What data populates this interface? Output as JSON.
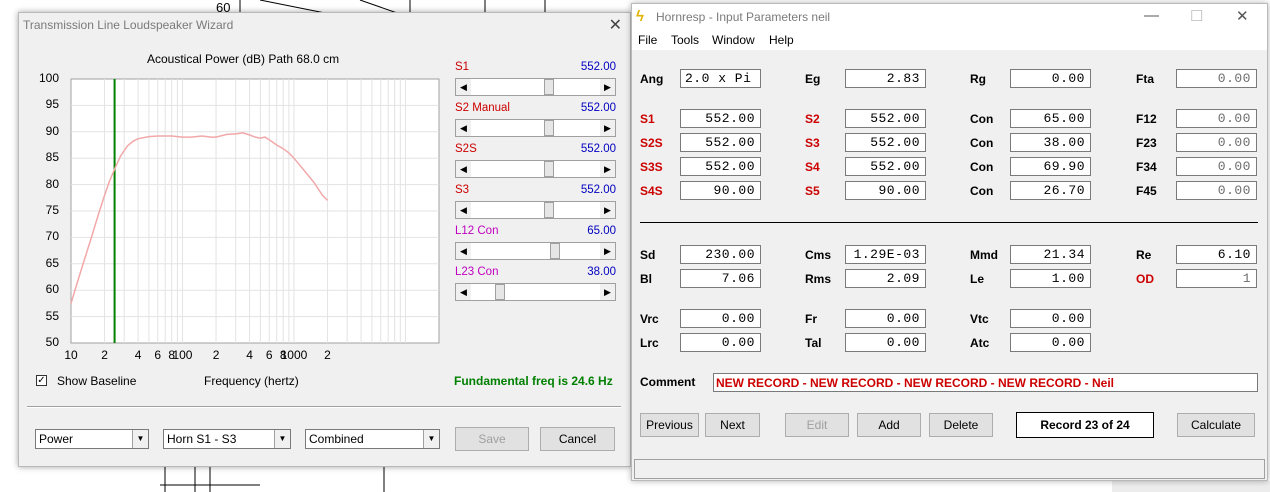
{
  "background": {
    "axis_label": "60"
  },
  "wizard": {
    "title": "Transmission Line Loudspeaker Wizard",
    "close_glyph": "✕",
    "chart_data": {
      "type": "line",
      "title": "Acoustical Power (dB)   Path 68.0 cm",
      "xlabel": "Frequency (hertz)",
      "ylabel": "",
      "xscale": "log",
      "xlim": [
        10,
        20000
      ],
      "ylim": [
        50,
        100
      ],
      "yticks": [
        "100",
        "95",
        "90",
        "85",
        "80",
        "75",
        "70",
        "65",
        "60",
        "55",
        "50"
      ],
      "xticks": [
        "10",
        "2",
        "4",
        "6",
        "8",
        "100",
        "2",
        "4",
        "6",
        "8",
        "1000",
        "2"
      ],
      "grid": true,
      "marker_x": 24.6,
      "series": [
        {
          "color": "#f2a8a8",
          "x": [
            10,
            12,
            15,
            18,
            20,
            22,
            25,
            28,
            32,
            36,
            40,
            50,
            60,
            80,
            100,
            120,
            150,
            180,
            200,
            250,
            300,
            350,
            400,
            450,
            500,
            550,
            600,
            700,
            800,
            900,
            1000,
            1200,
            1500,
            1800,
            2000
          ],
          "y": [
            57.5,
            63,
            69.5,
            75,
            78,
            80.5,
            83.3,
            85.5,
            87.3,
            88.2,
            88.7,
            89.1,
            89.2,
            89.2,
            89.0,
            89.0,
            89.2,
            89.0,
            89.0,
            89.5,
            89.6,
            89.8,
            89.4,
            89.0,
            88.8,
            89.0,
            88.5,
            87.5,
            86.8,
            86.0,
            85.0,
            83.0,
            80.5,
            78.0,
            77.0
          ]
        }
      ]
    },
    "fundamental": "Fundamental freq is 24.6 Hz",
    "sliders": [
      {
        "label": "S1",
        "value": "552.00",
        "label_color": "#cc0000",
        "position": 0.6
      },
      {
        "label": "S2  Manual",
        "value": "552.00",
        "label_color": "#cc0000",
        "position": 0.6
      },
      {
        "label": "S2S",
        "value": "552.00",
        "label_color": "#cc0000",
        "position": 0.6
      },
      {
        "label": "S3",
        "value": "552.00",
        "label_color": "#cc0000",
        "position": 0.6
      },
      {
        "label": "L12  Con",
        "value": "65.00",
        "label_color": "#c000c0",
        "position": 0.65
      },
      {
        "label": "L23  Con",
        "value": "38.00",
        "label_color": "#c000c0",
        "position": 0.2
      }
    ],
    "show_baseline": {
      "checked": true,
      "check_glyph": "✓",
      "label": "Show Baseline"
    },
    "combos": {
      "power": "Power",
      "horn": "Horn S1 - S3",
      "combined": "Combined"
    },
    "buttons": {
      "save": "Save",
      "cancel": "Cancel"
    },
    "glyphs": {
      "left": "◀",
      "right": "▶",
      "down": "▼"
    }
  },
  "hornresp": {
    "title": "Hornresp - Input Parameters   neil",
    "window_glyphs": {
      "minimize": "—",
      "maximize": "☐",
      "close": "✕"
    },
    "menu": [
      "File",
      "Tools",
      "Window",
      "Help"
    ],
    "params": {
      "ang": {
        "label": "Ang",
        "value": "2.0 x Pi"
      },
      "eg": {
        "label": "Eg",
        "value": "2.83"
      },
      "rg": {
        "label": "Rg",
        "value": "0.00"
      },
      "fta": {
        "label": "Fta",
        "value": "0.00"
      },
      "s1": {
        "label": "S1",
        "value": "552.00"
      },
      "s2": {
        "label": "S2",
        "value": "552.00"
      },
      "con1": {
        "label": "Con",
        "value": "65.00"
      },
      "f12": {
        "label": "F12",
        "value": "0.00"
      },
      "s2s": {
        "label": "S2S",
        "value": "552.00"
      },
      "s3": {
        "label": "S3",
        "value": "552.00"
      },
      "con2": {
        "label": "Con",
        "value": "38.00"
      },
      "f23": {
        "label": "F23",
        "value": "0.00"
      },
      "s3s": {
        "label": "S3S",
        "value": "552.00"
      },
      "s4": {
        "label": "S4",
        "value": "552.00"
      },
      "con3": {
        "label": "Con",
        "value": "69.90"
      },
      "f34": {
        "label": "F34",
        "value": "0.00"
      },
      "s4s": {
        "label": "S4S",
        "value": "90.00"
      },
      "s5": {
        "label": "S5",
        "value": "90.00"
      },
      "con4": {
        "label": "Con",
        "value": "26.70"
      },
      "f45": {
        "label": "F45",
        "value": "0.00"
      },
      "sd": {
        "label": "Sd",
        "value": "230.00"
      },
      "cms": {
        "label": "Cms",
        "value": "1.29E-03"
      },
      "mmd": {
        "label": "Mmd",
        "value": "21.34"
      },
      "re": {
        "label": "Re",
        "value": "6.10"
      },
      "bl": {
        "label": "Bl",
        "value": "7.06"
      },
      "rms": {
        "label": "Rms",
        "value": "2.09"
      },
      "le": {
        "label": "Le",
        "value": "1.00"
      },
      "od": {
        "label": "OD",
        "value": "1"
      },
      "vrc": {
        "label": "Vrc",
        "value": "0.00"
      },
      "fr": {
        "label": "Fr",
        "value": "0.00"
      },
      "vtc": {
        "label": "Vtc",
        "value": "0.00"
      },
      "lrc": {
        "label": "Lrc",
        "value": "0.00"
      },
      "tal": {
        "label": "Tal",
        "value": "0.00"
      },
      "atc": {
        "label": "Atc",
        "value": "0.00"
      }
    },
    "comment_label": "Comment",
    "comment_value": "NEW RECORD - NEW RECORD - NEW RECORD - NEW RECORD - Neil",
    "buttons": {
      "previous": "Previous",
      "next": "Next",
      "edit": "Edit",
      "add": "Add",
      "delete": "Delete",
      "calculate": "Calculate"
    },
    "record": "Record 23 of 24"
  }
}
